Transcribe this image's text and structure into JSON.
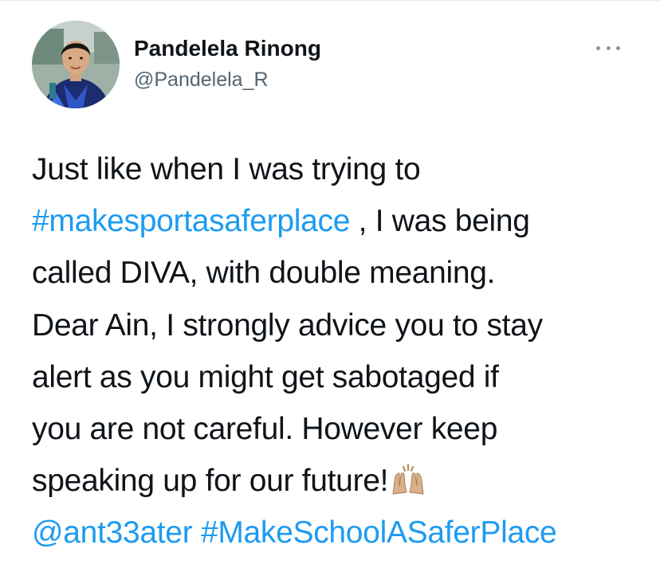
{
  "author": {
    "name": "Pandelela Rinong",
    "handle": "@Pandelela_R"
  },
  "more_icon": "more-horizontal-icon",
  "tweet": {
    "line1": "Just like when I was trying to",
    "hashtag1": "#makesportasaferplace",
    "line2_rest": " , I was being",
    "line3": "called DIVA, with double meaning.",
    "line4": "Dear Ain, I strongly advice you to stay",
    "line5": "alert as you might get sabotaged if",
    "line6": "you are not careful. However keep",
    "line7": "speaking up for our future!",
    "emoji": "raising-hands-emoji",
    "mention": "@ant33ater",
    "space": " ",
    "hashtag2": "#MakeSchoolASaferPlace"
  },
  "colors": {
    "link": "#1d9bf0",
    "text": "#0f1419",
    "secondary": "#536471"
  }
}
